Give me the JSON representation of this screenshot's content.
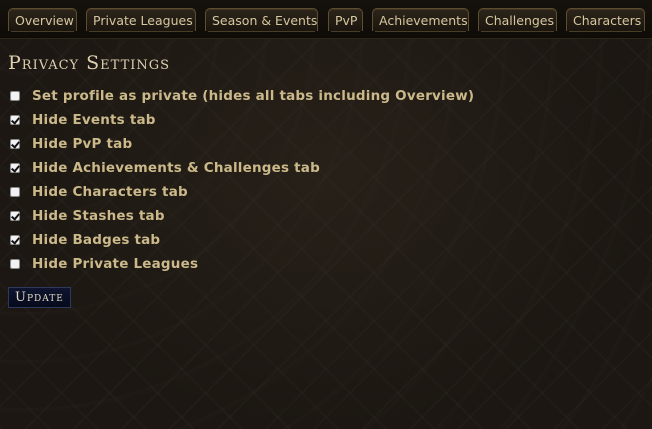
{
  "tabs": [
    {
      "label": "Overview"
    },
    {
      "label": "Private Leagues"
    },
    {
      "label": "Season & Events"
    },
    {
      "label": "PvP"
    },
    {
      "label": "Achievements"
    },
    {
      "label": "Challenges"
    },
    {
      "label": "Characters"
    }
  ],
  "heading": "Privacy Settings",
  "options": [
    {
      "label": "Set profile as private (hides all tabs including Overview)",
      "checked": false
    },
    {
      "label": "Hide Events tab",
      "checked": true
    },
    {
      "label": "Hide PvP tab",
      "checked": true
    },
    {
      "label": "Hide Achievements & Challenges tab",
      "checked": true
    },
    {
      "label": "Hide Characters tab",
      "checked": false
    },
    {
      "label": "Hide Stashes tab",
      "checked": true
    },
    {
      "label": "Hide Badges tab",
      "checked": true
    },
    {
      "label": "Hide Private Leagues",
      "checked": false
    }
  ],
  "update_button": "Update",
  "colors": {
    "background": "#1c1712",
    "text_gold": "#cbb98a",
    "heading": "#ddd0b0",
    "tab_border": "#5e4d2e",
    "button_bg": "#0f1530"
  }
}
